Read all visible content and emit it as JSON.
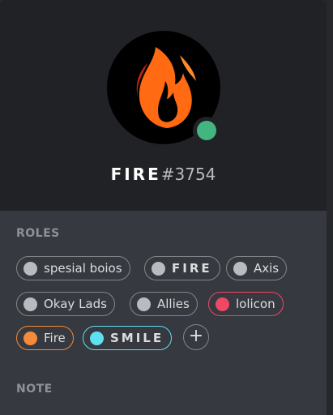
{
  "profile": {
    "username": "FIRE",
    "discriminator": "#3754",
    "avatar_icon": "flame-icon",
    "status_color": "#43b581"
  },
  "sections": {
    "roles_title": "ROLES",
    "note_title": "NOTE"
  },
  "roles": [
    {
      "label": "spesial boios",
      "color": "#b9bbbe"
    },
    {
      "label": "FIRE",
      "color": "#b9bbbe"
    },
    {
      "label": "Axis",
      "color": "#b9bbbe"
    },
    {
      "label": "Okay Lads",
      "color": "#b9bbbe"
    },
    {
      "label": "Allies",
      "color": "#b9bbbe"
    },
    {
      "label": "lolicon",
      "color": "#f04765"
    },
    {
      "label": "Fire",
      "color": "#f48a3a"
    },
    {
      "label": "SMILE",
      "color": "#5ee0f0"
    }
  ],
  "add_role_label": "+",
  "colors": {
    "header_bg": "#202225",
    "body_bg": "#36393f",
    "flame_orange": "#ff6a13"
  }
}
